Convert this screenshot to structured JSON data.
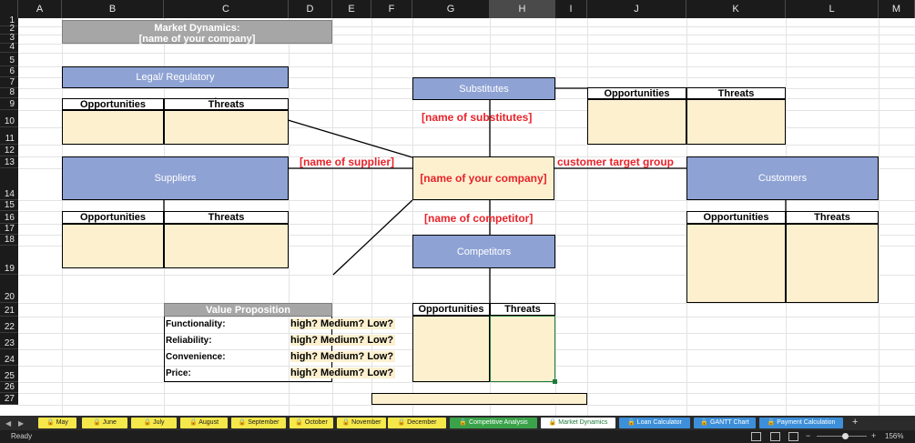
{
  "columns": [
    "A",
    "B",
    "C",
    "D",
    "E",
    "F",
    "G",
    "H",
    "I",
    "J",
    "K",
    "L",
    "M"
  ],
  "rows": [
    "1",
    "2",
    "3",
    "4",
    "5",
    "6",
    "7",
    "8",
    "9",
    "10",
    "11",
    "12",
    "13",
    "14",
    "15",
    "16",
    "17",
    "18",
    "19",
    "20",
    "21",
    "22",
    "23",
    "24",
    "25",
    "26",
    "27"
  ],
  "selected_column": "H",
  "title": {
    "line1": "Market Dynamics:",
    "line2": "[name of your company]"
  },
  "boxes": {
    "legal": "Legal/ Regulatory",
    "substitutes": "Substitutes",
    "suppliers": "Suppliers",
    "customers": "Customers",
    "competitors": "Competitors",
    "company": "[name of your company]"
  },
  "red_labels": {
    "substitutes": "[name  of substitutes]",
    "supplier": "[name of supplier]",
    "customer": "customer target group",
    "competitor": "[name of competitor]"
  },
  "table_headers": {
    "opportunities": "Opportunities",
    "threats": "Threats"
  },
  "value_prop": {
    "title": "Value Proposition",
    "rows": [
      {
        "label": "Functionality:",
        "value": "high? Medium? Low?"
      },
      {
        "label": "Reliability:",
        "value": "high? Medium? Low?"
      },
      {
        "label": "Convenience:",
        "value": "high? Medium? Low?"
      },
      {
        "label": "Price:",
        "value": "high? Medium? Low?"
      }
    ]
  },
  "tabs": [
    {
      "label": "May",
      "color": "#f5e84a"
    },
    {
      "label": "June",
      "color": "#f5e84a"
    },
    {
      "label": "July",
      "color": "#f5e84a"
    },
    {
      "label": "August",
      "color": "#f5e84a"
    },
    {
      "label": "September",
      "color": "#f5e84a"
    },
    {
      "label": "October",
      "color": "#f5e84a"
    },
    {
      "label": "November",
      "color": "#f5e84a"
    },
    {
      "label": "December",
      "color": "#f5e84a"
    },
    {
      "label": "Competitive Analysis",
      "color": "#3aa34a"
    },
    {
      "label": "Market Dynamics",
      "color": "#ffffff",
      "active": true
    },
    {
      "label": "Loan Calculator",
      "color": "#3d8fd9"
    },
    {
      "label": "GANTT Chart",
      "color": "#3d8fd9"
    },
    {
      "label": "Payment Calculation",
      "color": "#3d8fd9"
    }
  ],
  "add_tab": "+",
  "status": {
    "ready": "Ready",
    "zoom": "156%",
    "zoom_minus": "−",
    "zoom_plus": "+"
  }
}
